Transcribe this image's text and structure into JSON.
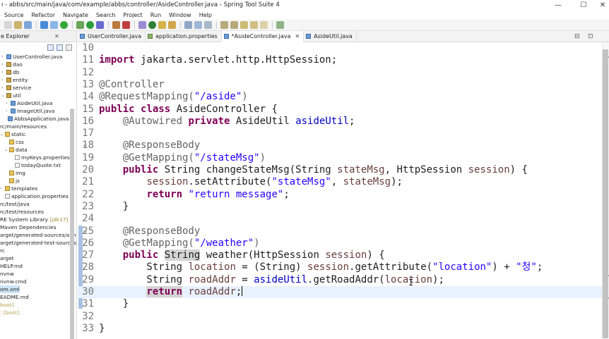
{
  "window": {
    "title": "ı - abbs/src/main/java/com/example/abbs/controller/AsideController.java - Spring Tool Suite 4",
    "minimize": "—",
    "maximize": "☐",
    "close": "✕"
  },
  "menu": [
    "Source",
    "Refactor",
    "Navigate",
    "Search",
    "Project",
    "Run",
    "Window",
    "Help"
  ],
  "explorer": {
    "tab_label": "e Explorer",
    "close": "✕",
    "items": [
      {
        "label": "UserController.java",
        "icon": "java-file-icon",
        "arrow": "›"
      },
      {
        "label": "dao",
        "icon": "package-icon",
        "arrow": "›"
      },
      {
        "label": "db",
        "icon": "package-icon",
        "arrow": "›"
      },
      {
        "label": "entity",
        "icon": "package-icon",
        "arrow": "›"
      },
      {
        "label": "service",
        "icon": "package-icon",
        "arrow": "›"
      },
      {
        "label": "util",
        "icon": "package-icon",
        "arrow": "⌄"
      },
      {
        "label": "AsideUtil.java",
        "icon": "java-file-icon",
        "arrow": "›"
      },
      {
        "label": "ImageUtil.java",
        "icon": "java-file-icon",
        "arrow": "›"
      },
      {
        "label": "AbbsApplication.java",
        "icon": "java-file-icon",
        "arrow": ""
      },
      {
        "label": "rc/main/resources",
        "icon": "",
        "arrow": ""
      },
      {
        "label": "static",
        "icon": "folder-icon",
        "arrow": "⌄"
      },
      {
        "label": "css",
        "icon": "folder-icon",
        "arrow": ""
      },
      {
        "label": "data",
        "icon": "folder-icon",
        "arrow": "⌄"
      },
      {
        "label": "myKeys.properties",
        "icon": "file-icon",
        "arrow": ""
      },
      {
        "label": "todayQuote.txt",
        "icon": "file-icon",
        "arrow": ""
      },
      {
        "label": "img",
        "icon": "folder-icon",
        "arrow": ""
      },
      {
        "label": "js",
        "icon": "folder-icon",
        "arrow": ""
      },
      {
        "label": "templates",
        "icon": "folder-icon",
        "arrow": "›"
      },
      {
        "label": "application.properties",
        "icon": "file-icon",
        "arrow": ""
      },
      {
        "label": "rc/test/java",
        "icon": "",
        "arrow": ""
      },
      {
        "label": "rc/test/resources",
        "icon": "",
        "arrow": ""
      },
      {
        "label": "RE System Library ",
        "suffix": "[jdk17]",
        "icon": "",
        "arrow": ""
      },
      {
        "label": "Maven Dependencies",
        "icon": "",
        "arrow": ""
      },
      {
        "label": "arget/generated-sources/anno",
        "icon": "",
        "arrow": ""
      },
      {
        "label": "arget/generated-test-sources/",
        "icon": "",
        "arrow": ""
      },
      {
        "label": "rc",
        "icon": "",
        "arrow": ""
      },
      {
        "label": "arget",
        "icon": "",
        "arrow": ""
      },
      {
        "label": "HELP.md",
        "icon": "",
        "arrow": ""
      },
      {
        "label": "nvnw",
        "icon": "",
        "arrow": ""
      },
      {
        "label": "nvnw.cmd",
        "icon": "",
        "arrow": ""
      },
      {
        "label": "om.xml",
        "icon": "",
        "arrow": "",
        "selected": true
      },
      {
        "label": "EADME.md",
        "icon": "",
        "arrow": ""
      },
      {
        "label": "boot]",
        "icon": "",
        "arrow": "",
        "style": "boot"
      },
      {
        "label": ": [boot]",
        "icon": "",
        "arrow": "",
        "style": "boot"
      }
    ]
  },
  "editor_tabs": [
    {
      "label": "UserController.java",
      "icon": "java-file-icon",
      "active": false
    },
    {
      "label": "application.properties",
      "icon": "properties-file-icon",
      "active": false
    },
    {
      "label": "*AsideController.java",
      "icon": "java-file-icon",
      "active": true
    },
    {
      "label": "AsideUtil.java",
      "icon": "java-file-icon",
      "active": false
    }
  ],
  "editor": {
    "tab_close": "✕",
    "minimize_icon": "⊟",
    "maximize_icon": "⊡",
    "current_line": 30,
    "lines": [
      {
        "n": "10",
        "tokens": []
      },
      {
        "n": "11",
        "tokens": [
          {
            "t": "import",
            "c": "kw"
          },
          {
            "t": " jakarta.servlet.http.HttpSession;",
            "c": ""
          }
        ]
      },
      {
        "n": "12",
        "tokens": []
      },
      {
        "n": "13",
        "tokens": [
          {
            "t": "@Controller",
            "c": "ann"
          }
        ]
      },
      {
        "n": "14",
        "tokens": [
          {
            "t": "@RequestMapping(",
            "c": "ann"
          },
          {
            "t": "\"/aside\"",
            "c": "str"
          },
          {
            "t": ")",
            "c": "ann"
          }
        ]
      },
      {
        "n": "15",
        "tokens": [
          {
            "t": "public",
            "c": "kw"
          },
          {
            "t": " ",
            "c": ""
          },
          {
            "t": "class",
            "c": "kw"
          },
          {
            "t": " AsideController {",
            "c": ""
          }
        ]
      },
      {
        "n": "16",
        "tokens": [
          {
            "t": "    ",
            "c": ""
          },
          {
            "t": "@Autowired",
            "c": "ann"
          },
          {
            "t": " ",
            "c": ""
          },
          {
            "t": "private",
            "c": "kw"
          },
          {
            "t": " AsideUtil ",
            "c": ""
          },
          {
            "t": "asideUtil",
            "c": "fld"
          },
          {
            "t": ";",
            "c": ""
          }
        ]
      },
      {
        "n": "17",
        "tokens": []
      },
      {
        "n": "18",
        "fold": "⊖",
        "tokens": [
          {
            "t": "    ",
            "c": ""
          },
          {
            "t": "@ResponseBody",
            "c": "ann"
          }
        ]
      },
      {
        "n": "19",
        "tokens": [
          {
            "t": "    ",
            "c": ""
          },
          {
            "t": "@GetMapping(",
            "c": "ann"
          },
          {
            "t": "\"/stateMsg\"",
            "c": "str"
          },
          {
            "t": ")",
            "c": "ann"
          }
        ]
      },
      {
        "n": "20",
        "tokens": [
          {
            "t": "    ",
            "c": ""
          },
          {
            "t": "public",
            "c": "kw"
          },
          {
            "t": " String changeStateMsg(String ",
            "c": ""
          },
          {
            "t": "stateMsg",
            "c": "var"
          },
          {
            "t": ", HttpSession ",
            "c": ""
          },
          {
            "t": "session",
            "c": "var"
          },
          {
            "t": ") {",
            "c": ""
          }
        ]
      },
      {
        "n": "21",
        "tokens": [
          {
            "t": "        ",
            "c": ""
          },
          {
            "t": "session",
            "c": "var"
          },
          {
            "t": ".setAttribute(",
            "c": ""
          },
          {
            "t": "\"stateMsg\"",
            "c": "str"
          },
          {
            "t": ", ",
            "c": ""
          },
          {
            "t": "stateMsg",
            "c": "var"
          },
          {
            "t": ");",
            "c": ""
          }
        ]
      },
      {
        "n": "22",
        "tokens": [
          {
            "t": "        ",
            "c": ""
          },
          {
            "t": "return",
            "c": "kw"
          },
          {
            "t": " ",
            "c": ""
          },
          {
            "t": "\"return message\"",
            "c": "str"
          },
          {
            "t": ";",
            "c": ""
          }
        ]
      },
      {
        "n": "23",
        "tokens": [
          {
            "t": "    }",
            "c": ""
          }
        ]
      },
      {
        "n": "24",
        "tokens": []
      },
      {
        "n": "25",
        "fold": "⊖",
        "tokens": [
          {
            "t": "    ",
            "c": ""
          },
          {
            "t": "@ResponseBody",
            "c": "ann"
          }
        ]
      },
      {
        "n": "26",
        "tokens": [
          {
            "t": "    ",
            "c": ""
          },
          {
            "t": "@GetMapping(",
            "c": "ann"
          },
          {
            "t": "\"/weather\"",
            "c": "str"
          },
          {
            "t": ")",
            "c": "ann"
          }
        ]
      },
      {
        "n": "27",
        "tokens": [
          {
            "t": "    ",
            "c": ""
          },
          {
            "t": "public",
            "c": "kw"
          },
          {
            "t": " ",
            "c": ""
          },
          {
            "t": "String",
            "c": "occ"
          },
          {
            "t": " weather(HttpSession ",
            "c": ""
          },
          {
            "t": "session",
            "c": "var"
          },
          {
            "t": ") {",
            "c": ""
          }
        ]
      },
      {
        "n": "28",
        "tokens": [
          {
            "t": "        String ",
            "c": ""
          },
          {
            "t": "location",
            "c": "var"
          },
          {
            "t": " = (String) ",
            "c": ""
          },
          {
            "t": "session",
            "c": "var"
          },
          {
            "t": ".getAttribute(",
            "c": ""
          },
          {
            "t": "\"location\"",
            "c": "str"
          },
          {
            "t": ") + ",
            "c": ""
          },
          {
            "t": "\"청\"",
            "c": "str"
          },
          {
            "t": ";",
            "c": ""
          }
        ]
      },
      {
        "n": "29",
        "tokens": [
          {
            "t": "        String ",
            "c": ""
          },
          {
            "t": "roadAddr",
            "c": "var"
          },
          {
            "t": " = ",
            "c": ""
          },
          {
            "t": "asideUtil",
            "c": "fld"
          },
          {
            "t": ".getRoadAddr(",
            "c": ""
          },
          {
            "t": "location",
            "c": "var"
          },
          {
            "t": ");",
            "c": ""
          }
        ]
      },
      {
        "n": "30",
        "tokens": [
          {
            "t": "        ",
            "c": ""
          },
          {
            "t": "return",
            "c": "kw occ"
          },
          {
            "t": " ",
            "c": ""
          },
          {
            "t": "roadAddr",
            "c": "var"
          },
          {
            "t": ";",
            "c": ""
          }
        ],
        "caret": true
      },
      {
        "n": "31",
        "tokens": [
          {
            "t": "    }",
            "c": ""
          }
        ]
      },
      {
        "n": "32",
        "tokens": []
      },
      {
        "n": "33",
        "tokens": [
          {
            "t": "}",
            "c": ""
          }
        ]
      }
    ],
    "ibeam": "I"
  },
  "colors": {
    "keyword": "#7f0055",
    "annotation": "#646464",
    "string": "#2a00ff",
    "field": "#0000c0",
    "local_variable": "#6a3e3e",
    "current_line": "#e8f2fe"
  }
}
